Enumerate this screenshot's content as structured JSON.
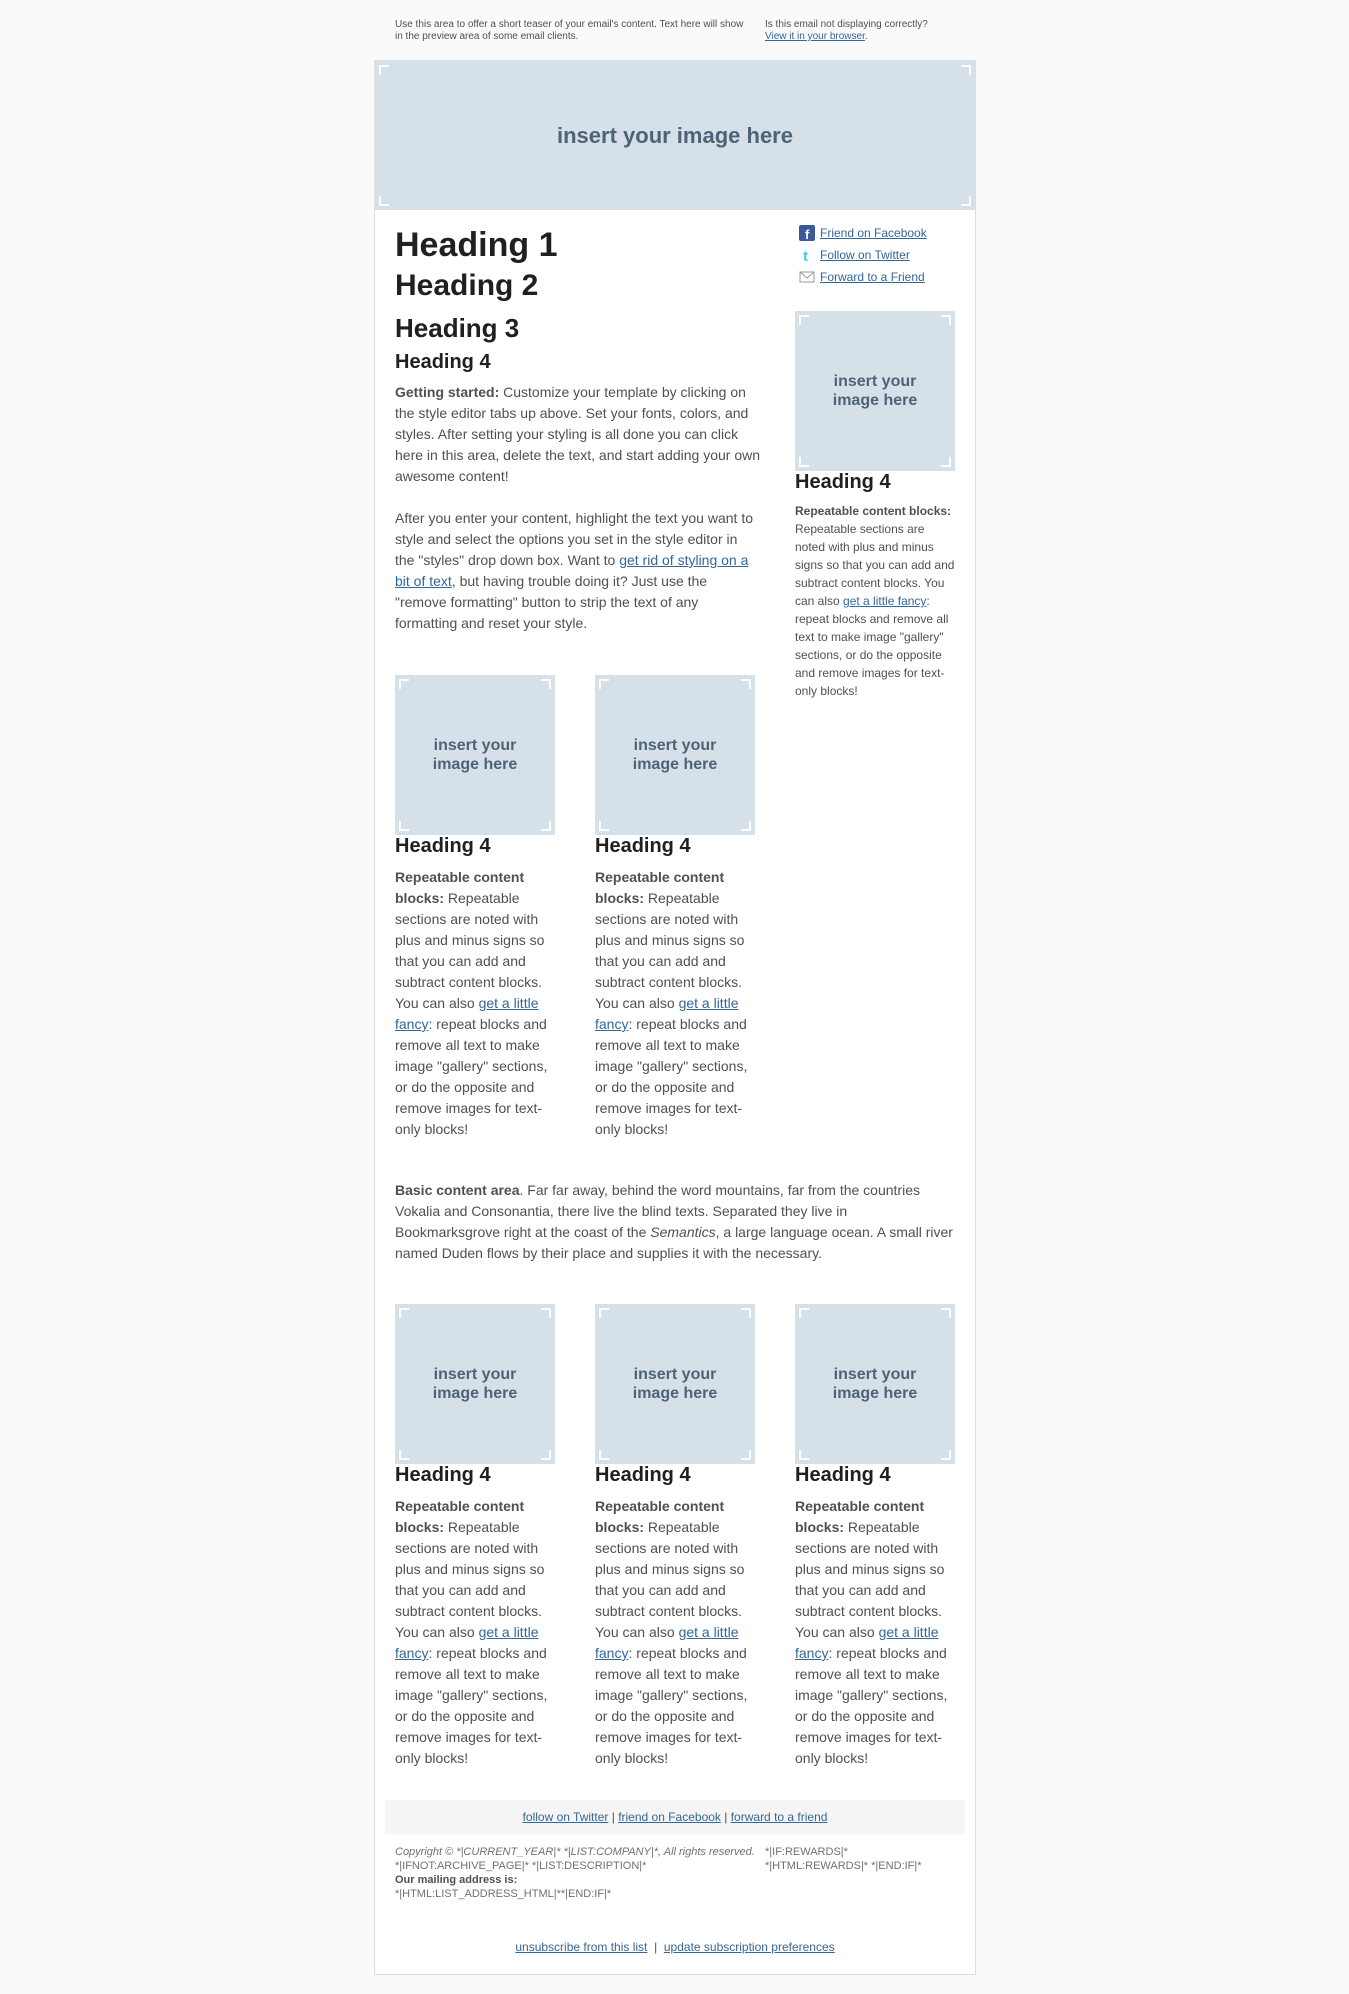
{
  "preheader": {
    "teaser": "Use this area to offer a short teaser of your email's content. Text here will show in the preview area of some email clients.",
    "browser_question": "Is this email not displaying correctly?",
    "browser_link": "View it in your browser",
    "browser_link_suffix": "."
  },
  "header_image": {
    "text": "insert your image here"
  },
  "main": {
    "heading1": "Heading 1",
    "heading2": "Heading 2",
    "heading3": "Heading 3",
    "heading4": "Heading 4",
    "p1_bold": "Getting started:",
    "p1_text": " Customize your template by clicking on the style editor tabs up above. Set your fonts, colors, and styles. After setting your styling is all done you can click here in this area, delete the text, and start adding your own awesome content!",
    "p2_before": "After you enter your content, highlight the text you want to style and select the options you set in the style editor in the \"styles\" drop down box. Want to ",
    "p2_link": "get rid of styling on a bit of text",
    "p2_after": ", but having trouble doing it? Just use the \"remove formatting\" button to strip the text of any formatting and reset your style."
  },
  "social": {
    "facebook": "Friend on Facebook",
    "twitter": "Follow on Twitter",
    "forward": "Forward to a Friend"
  },
  "block": {
    "image_text": "insert your image here",
    "heading": "Heading 4",
    "bold": "Repeatable content blocks:",
    "text_before": " Repeatable sections are noted with plus and minus signs so that you can add and subtract content blocks. You can also ",
    "link": "get a little fancy",
    "text_after": ": repeat blocks and remove all text to make image \"gallery\" sections, or do the opposite and remove images for text-only blocks!"
  },
  "basic": {
    "bold": "Basic content area",
    "text1": ". Far far away, behind the word mountains, far from the countries Vokalia and Consonantia, there live the blind texts. Separated they live in Bookmarksgrove right at the coast of the ",
    "italic": "Semantics",
    "text2": ", a large language ocean. A small river named Duden flows by their place and supplies it with the necessary."
  },
  "footer": {
    "twitter": "follow on Twitter",
    "facebook": "friend on Facebook",
    "forward": "forward to a friend",
    "sep": " | ",
    "copyright": "Copyright © *|CURRENT_YEAR|* *|LIST:COMPANY|*, All rights reserved.",
    "archive": "*|IFNOT:ARCHIVE_PAGE|* *|LIST:DESCRIPTION|*",
    "mailing_label": "Our mailing address is:",
    "address": "*|HTML:LIST_ADDRESS_HTML|**|END:IF|*",
    "rewards1": "*|IF:REWARDS|*",
    "rewards2": "*|HTML:REWARDS|* *|END:IF|*",
    "unsubscribe": "unsubscribe from this list",
    "update": "update subscription preferences"
  },
  "colors": {
    "placeholder": "#d6e0e8",
    "placeholder_text": "#4e6378",
    "link": "#336699",
    "heading": "#202020",
    "body_text": "#505050"
  }
}
